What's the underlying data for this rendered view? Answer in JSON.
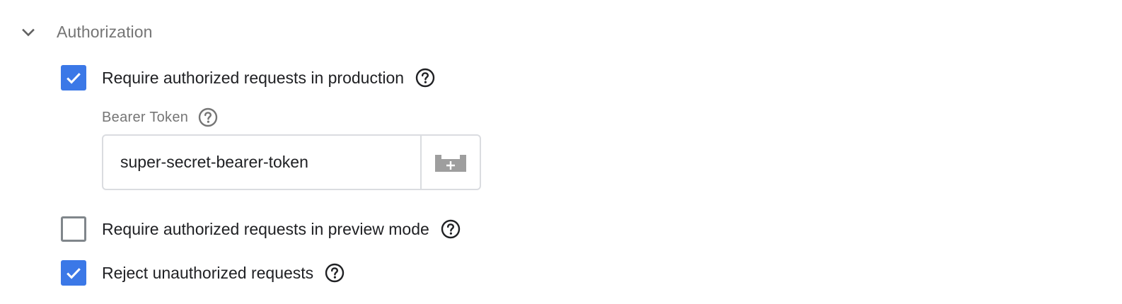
{
  "section": {
    "title": "Authorization",
    "expanded": true,
    "chevron_icon": "chevron-down-icon"
  },
  "options": {
    "require_production": {
      "label": "Require authorized requests in production",
      "checked": true,
      "help_icon": "help-circle-icon"
    },
    "require_preview": {
      "label": "Require authorized requests in preview mode",
      "checked": false,
      "help_icon": "help-circle-icon"
    },
    "reject_unauthorized": {
      "label": "Reject unauthorized requests",
      "checked": true,
      "help_icon": "help-circle-icon"
    }
  },
  "bearer_token": {
    "label": "Bearer Token",
    "value": "super-secret-bearer-token",
    "help_icon": "help-circle-icon",
    "variable_button_icon": "add-variable-brick-icon"
  },
  "colors": {
    "checkbox_checked": "#3b78e7",
    "checkbox_border": "#80868b",
    "label_grey": "#757575",
    "text": "#202124",
    "field_border": "#dadce0",
    "variable_icon": "#9e9e9e"
  }
}
